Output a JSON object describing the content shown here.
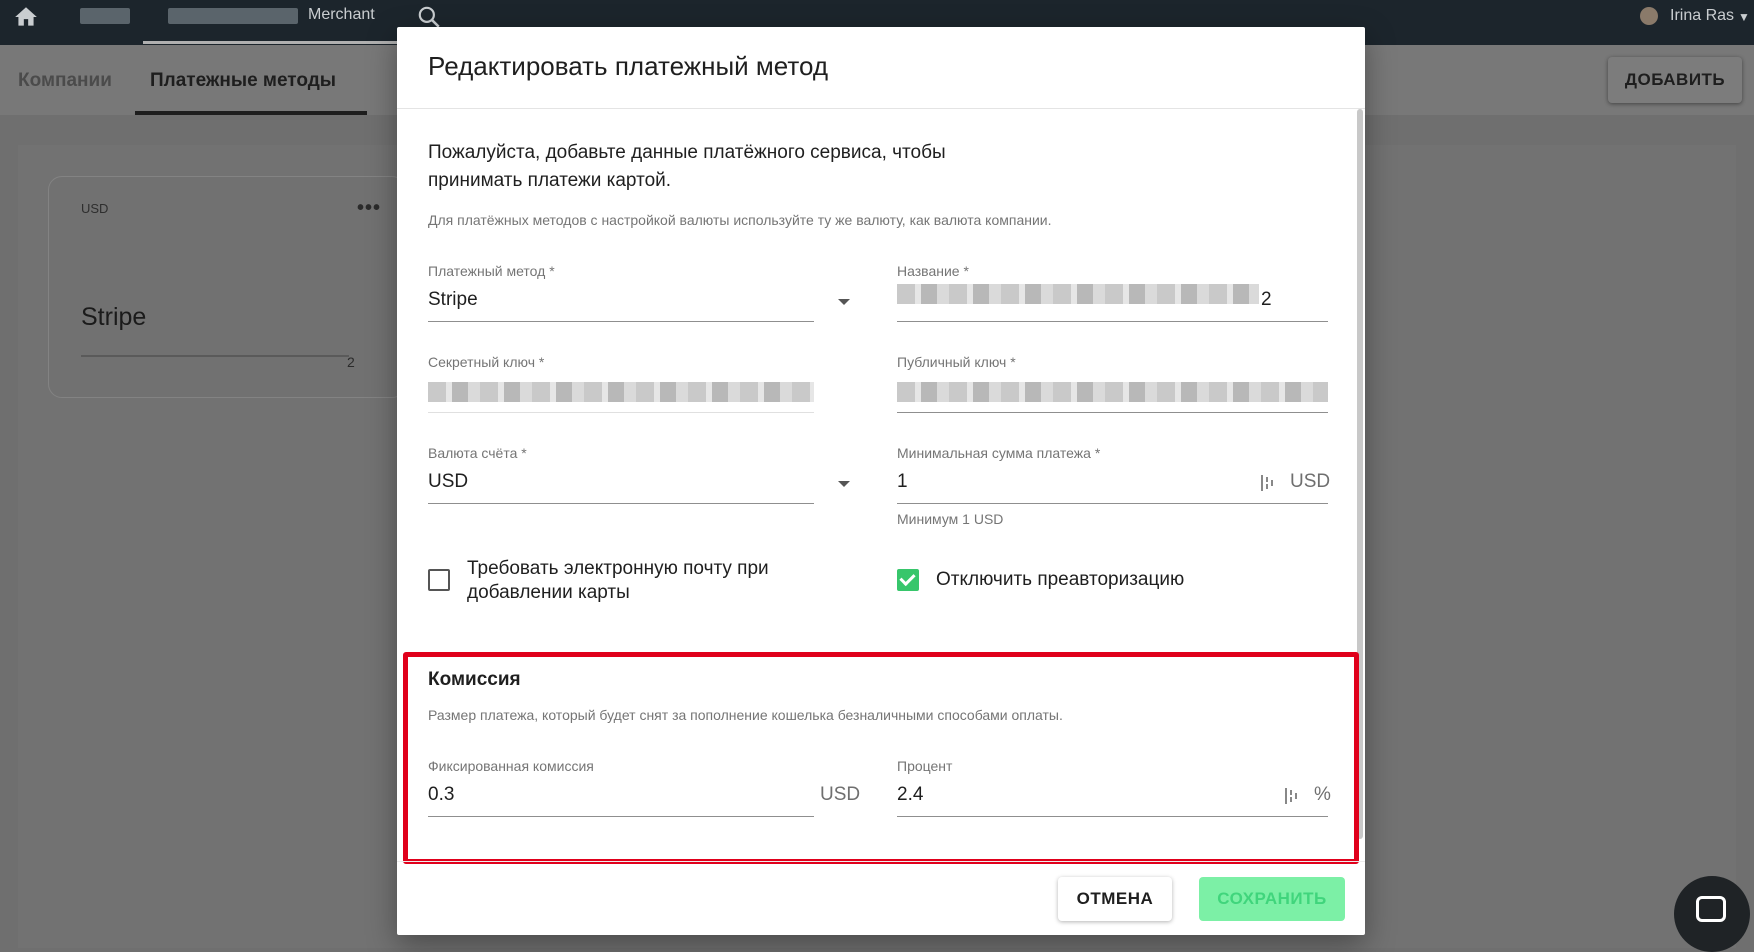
{
  "topbar": {
    "merchant_label": "Merchant",
    "user_name": "Irina Ras"
  },
  "subnav": {
    "tabs": [
      {
        "label": "Компании",
        "active": false
      },
      {
        "label": "Платежные методы",
        "active": true
      }
    ],
    "add_button": "ДОБАВИТЬ"
  },
  "card": {
    "currency": "USD",
    "menu": "•••",
    "name": "Stripe",
    "key_suffix": "2"
  },
  "dialog": {
    "title": "Редактировать платежный метод",
    "intro": "Пожалуйста, добавьте данные платёжного сервиса, чтобы принимать платежи картой.",
    "hint": "Для платёжных методов с настройкой валюты используйте ту же валюту, как валюта компании.",
    "fields": {
      "payment_method": {
        "label": "Платежный метод *",
        "value": "Stripe"
      },
      "name": {
        "label": "Название *",
        "value_suffix": "2"
      },
      "secret_key": {
        "label": "Секретный ключ *"
      },
      "public_key": {
        "label": "Публичный ключ *"
      },
      "currency": {
        "label": "Валюта счёта *",
        "value": "USD"
      },
      "min_amount": {
        "label": "Минимальная сумма платежа *",
        "value": "1",
        "unit": "USD",
        "helper": "Минимум 1 USD"
      }
    },
    "checkboxes": {
      "require_email": {
        "label": "Требовать электронную почту при добавлении карты",
        "checked": false
      },
      "disable_preauth": {
        "label": "Отключить преавторизацию",
        "checked": true
      }
    },
    "commission": {
      "title": "Комиссия",
      "hint": "Размер платежа, который будет снят за пополнение кошелька безналичными способами оплаты.",
      "fixed": {
        "label": "Фиксированная комиссия",
        "value": "0.3",
        "unit": "USD"
      },
      "percent": {
        "label": "Процент",
        "value": "2.4",
        "unit": "%"
      }
    },
    "buttons": {
      "cancel": "ОТМЕНА",
      "save": "СОХРАНИТЬ"
    }
  },
  "colors": {
    "accent_green": "#37c66b",
    "save_button_bg": "#7cf0a6",
    "highlight_red": "#e0001b",
    "topbar": "#1c252c"
  }
}
